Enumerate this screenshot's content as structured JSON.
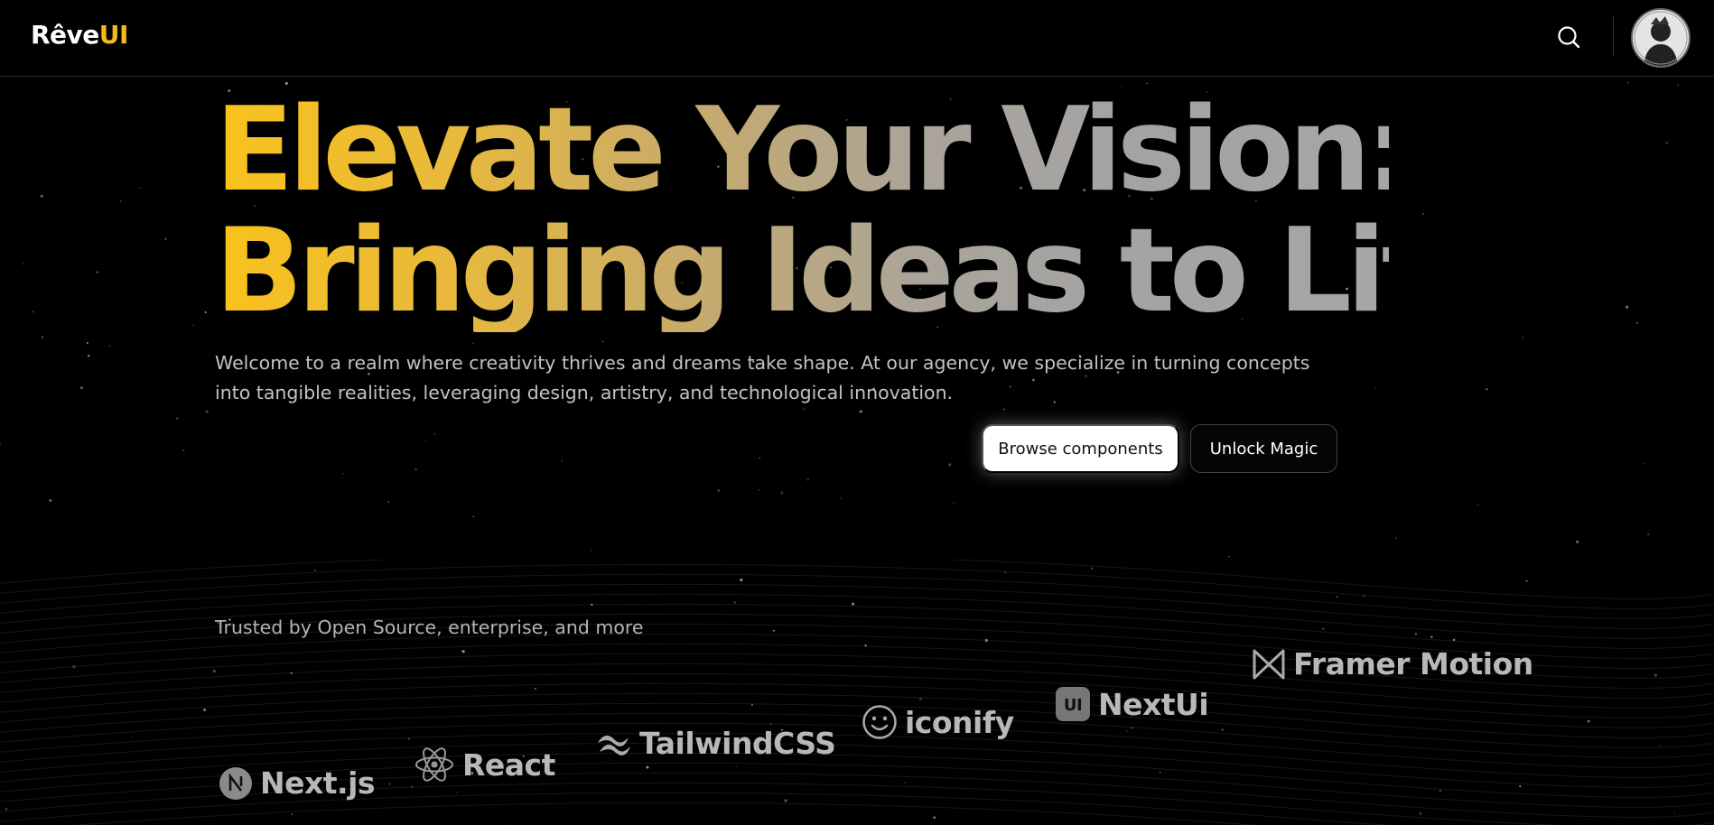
{
  "nav": {
    "logo_part1": "Rêve",
    "logo_part2": "UI",
    "search_icon": "search-icon",
    "avatar_icon": "user-avatar"
  },
  "hero": {
    "title_line1": "Elevate Your Vision:",
    "title_line2": "Bringing Ideas to Life",
    "subtitle": "Welcome to a realm where creativity thrives and dreams take shape. At our agency, we specialize in turning concepts into tangible realities, leveraging design, artistry, and technological innovation.",
    "primary_button": "Browse components",
    "secondary_button": "Unlock Magic"
  },
  "trusted": {
    "label": "Trusted by Open Source, enterprise, and more",
    "brands": [
      {
        "name": "Next.js",
        "icon": "nextjs-icon"
      },
      {
        "name": "React",
        "icon": "react-icon"
      },
      {
        "name": "TailwindCSS",
        "icon": "tailwind-icon"
      },
      {
        "name": "iconify",
        "icon": "iconify-icon"
      },
      {
        "name": "NextUi",
        "icon": "nextui-icon"
      },
      {
        "name": "Framer Motion",
        "icon": "framer-motion-icon"
      }
    ]
  },
  "colors": {
    "background": "#000000",
    "accent_gold": "#f5b91c",
    "title_gray": "#a6a6a8",
    "text_muted": "#c2c2c2"
  }
}
